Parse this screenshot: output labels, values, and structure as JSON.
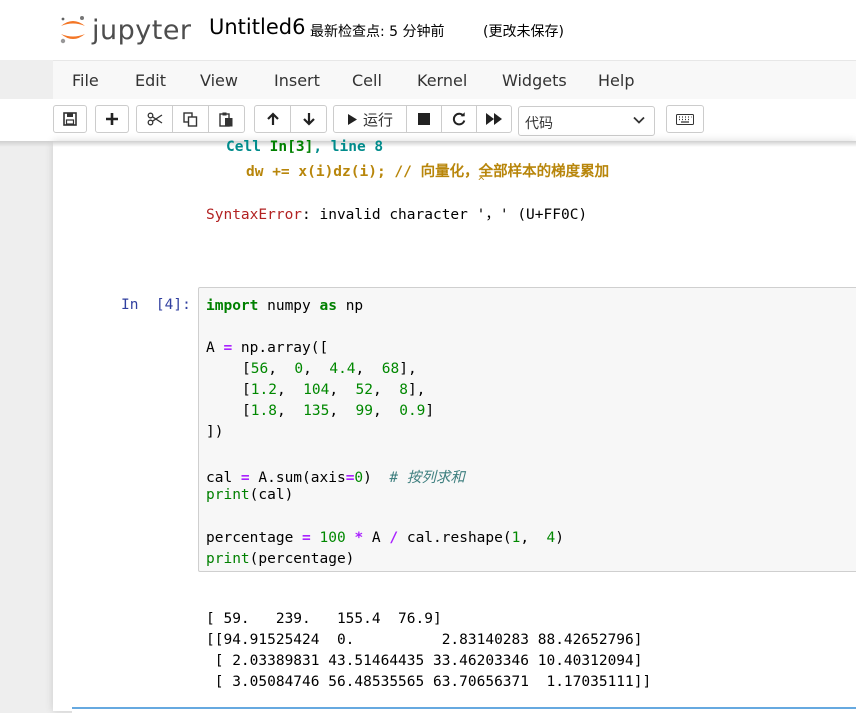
{
  "header": {
    "logo_text": "jupyter",
    "notebook_title": "Untitled6",
    "checkpoint": "最新检查点: 5 分钟前",
    "autosave": "(更改未保存)"
  },
  "menu": [
    "File",
    "Edit",
    "View",
    "Insert",
    "Cell",
    "Kernel",
    "Widgets",
    "Help"
  ],
  "toolbar": {
    "run_label": "运行",
    "cell_type": "代码",
    "icons": [
      "save-icon",
      "plus-icon",
      "cut-icon",
      "copy-icon",
      "paste-icon",
      "arrow-up-icon",
      "arrow-down-icon",
      "play-icon",
      "stop-icon",
      "restart-icon",
      "fast-forward-icon",
      "keyboard-icon"
    ]
  },
  "error_output": {
    "location_prefix": "Cell ",
    "location_cell": "In[3]",
    "location_suffix": ", line 8",
    "code_line": "dw += x(i)dz(i); // 向量化，全部样本的梯度累加",
    "caret": "^",
    "error_type": "SyntaxError",
    "error_message": ": invalid character '，' (U+FF0C)"
  },
  "cell": {
    "prompt": "In  [4]:",
    "lines": [
      "import numpy as np",
      "",
      "A = np.array([",
      "    [56, 0, 4.4, 68],",
      "    [1.2, 104, 52, 8],",
      "    [1.8, 135, 99, 0.9]",
      "])",
      "",
      "cal = A.sum(axis=0)  # 按列求和",
      "print(cal)",
      "",
      "percentage = 100 * A / cal.reshape(1, 4)",
      "print(percentage)"
    ],
    "tokens": {
      "import": "import",
      "numpy": " numpy ",
      "as": "as",
      "np": " np",
      "A_eq": "A ",
      "eq": "=",
      "nparray": " np.array([",
      "r1": [
        "[",
        "56",
        ",  ",
        "0",
        ",  ",
        "4.4",
        ",  ",
        "68",
        "],"
      ],
      "r2": [
        "[",
        "1.2",
        ",  ",
        "104",
        ",  ",
        "52",
        ",  ",
        "8",
        "],"
      ],
      "r3": [
        "[",
        "1.8",
        ",  ",
        "135",
        ",  ",
        "99",
        ",  ",
        "0.9",
        "]"
      ],
      "close": "])",
      "cal_a": "cal ",
      "cal_b": " A.sum(axis",
      "cal_c": "0",
      "cal_d": ")  ",
      "cal_comment": "# 按列求和",
      "print1_a": "print",
      "print1_b": "(cal)",
      "pct_a": "percentage ",
      "pct_num100": "100",
      "pct_star": "*",
      "pct_a2": " A ",
      "pct_slash": "/",
      "pct_b": " cal.reshape(",
      "pct_1": "1",
      "pct_comma": ",  ",
      "pct_4": "4",
      "pct_close": ")",
      "print2_a": "print",
      "print2_b": "(percentage)"
    }
  },
  "output": [
    "[ 59.   239.   155.4  76.9]",
    "[[94.91525424  0.          2.83140283 88.42652796]",
    " [ 2.03389831 43.51464435 33.46203346 10.40312094]",
    " [ 3.05084746 56.48535565 63.70656371  1.17035111]]"
  ]
}
